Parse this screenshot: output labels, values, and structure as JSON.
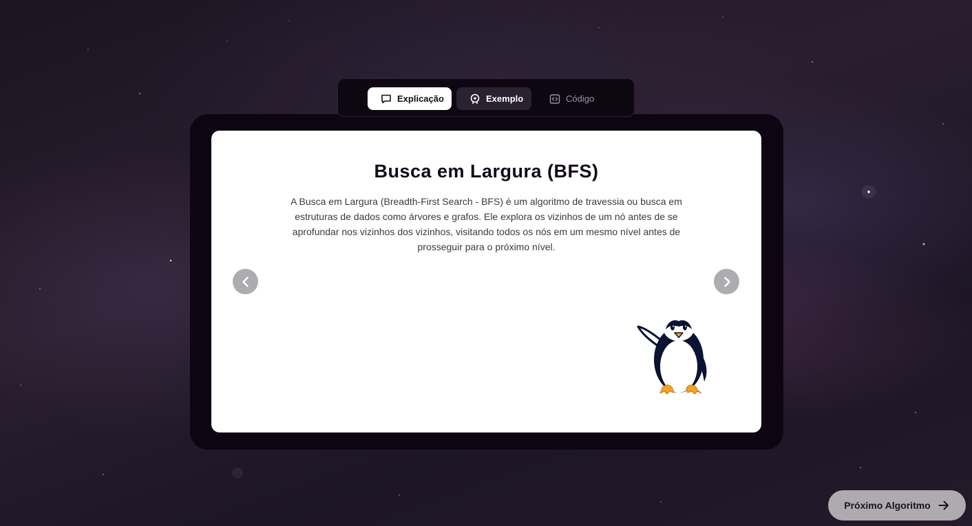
{
  "tabs": [
    {
      "label": "Explicação",
      "icon": "message-square-icon",
      "active": true
    },
    {
      "label": "Exemplo",
      "icon": "brain-icon",
      "active": false
    },
    {
      "label": "Código",
      "icon": "code-icon",
      "active": false
    }
  ],
  "card": {
    "title": "Busca em Largura (BFS)",
    "description": "A Busca em Largura (Breadth-First Search - BFS) é um algoritmo de travessia ou busca em estruturas de dados como árvores e grafos. Ele explora os vizinhos de um nó antes de se aprofundar nos vizinhos dos vizinhos, visitando todos os nós em um mesmo nível antes de prosseguir para o próximo nível.",
    "prev_icon": "chevron-left-icon",
    "next_icon": "chevron-right-icon",
    "mascot": "penguin-mascot"
  },
  "footer": {
    "next_algorithm_label": "Próximo Algoritmo",
    "next_algorithm_icon": "arrow-right-icon"
  },
  "colors": {
    "active_tab_bg": "#ffffff",
    "tab_bar_bg": "#0d0712",
    "card_frame": "#0e0512",
    "nav_arrow": "#adacae",
    "next_button_bg": "#aeaaaf"
  }
}
